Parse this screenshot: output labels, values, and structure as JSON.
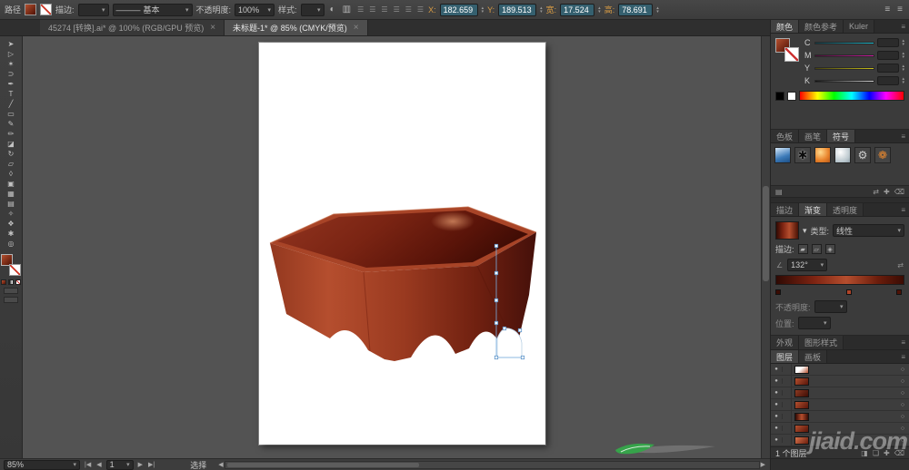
{
  "glyphs": {
    "menu": "≡",
    "close": "×",
    "dropdown": "▾",
    "up": "▴",
    "down": "▾",
    "half_circle": "◐",
    "doc": "▥",
    "align": "☰",
    "angle": "∠",
    "swap": "⇄",
    "eye": "●",
    "target": "○",
    "plus": "✚",
    "trash": "⌫",
    "folder": "❏",
    "clip": "◨",
    "library": "▤",
    "first": "|◀",
    "prev": "◀",
    "next": "▶",
    "last": "▶|",
    "gb1": "▰",
    "gb2": "▱",
    "gb3": "◈",
    "line": "———"
  },
  "top_bar": {
    "object_label": "路径",
    "stroke_label": "描边:",
    "brush_style": "基本",
    "opacity_label": "不透明度:",
    "opacity_value": "100%",
    "style_label": "样式:",
    "x_label": "X:",
    "x_value": "182.659",
    "y_label": "Y:",
    "y_value": "189.513",
    "w_label": "宽:",
    "w_value": "17.524",
    "h_label": "高:",
    "h_value": "78.691"
  },
  "document_tabs": [
    {
      "label": "45274 [转换].ai* @ 100% (RGB/GPU 预览)",
      "close": "×"
    },
    {
      "label": "未标题-1* @ 85% (CMYK/预览)",
      "close": "×",
      "active": true
    }
  ],
  "toolbar": {
    "tools": [
      {
        "name": "selection-tool",
        "glyph": "➤"
      },
      {
        "name": "direct-selection-tool",
        "glyph": "▷"
      },
      {
        "name": "magic-wand-tool",
        "glyph": "✶"
      },
      {
        "name": "lasso-tool",
        "glyph": "⊃"
      },
      {
        "name": "pen-tool",
        "glyph": "✒"
      },
      {
        "name": "type-tool",
        "glyph": "T"
      },
      {
        "name": "line-segment-tool",
        "glyph": "╱"
      },
      {
        "name": "rectangle-tool",
        "glyph": "▭"
      },
      {
        "name": "paintbrush-tool",
        "glyph": "✎"
      },
      {
        "name": "pencil-tool",
        "glyph": "✏"
      },
      {
        "name": "eraser-tool",
        "glyph": "◪"
      },
      {
        "name": "rotate-tool",
        "glyph": "↻"
      },
      {
        "name": "scale-tool",
        "glyph": "▱"
      },
      {
        "name": "width-tool",
        "glyph": "◊"
      },
      {
        "name": "free-transform-tool",
        "glyph": "▣"
      },
      {
        "name": "mesh-tool",
        "glyph": "▦"
      },
      {
        "name": "gradient-tool",
        "glyph": "▤"
      },
      {
        "name": "eyedropper-tool",
        "glyph": "✧"
      },
      {
        "name": "blend-tool",
        "glyph": "❖"
      },
      {
        "name": "hand-tool",
        "glyph": "✱"
      },
      {
        "name": "zoom-tool",
        "glyph": "◎"
      }
    ]
  },
  "panels": {
    "color": {
      "tabs": [
        {
          "label": "颜色",
          "active": true
        },
        {
          "label": "颜色参考"
        },
        {
          "label": "Kuler"
        }
      ],
      "channels": [
        "C",
        "M",
        "Y",
        "K"
      ]
    },
    "symbols": {
      "tabs": [
        {
          "label": "色板"
        },
        {
          "label": "画笔"
        },
        {
          "label": "符号",
          "active": true
        }
      ],
      "items": [
        {
          "name": "symbol-blue-square",
          "cls": "sym-blue"
        },
        {
          "name": "symbol-ink-splat",
          "cls": "sym-splat",
          "glyph": "✱"
        },
        {
          "name": "symbol-orange-sphere",
          "cls": "sym-orange"
        },
        {
          "name": "symbol-light-sphere",
          "cls": "sym-light"
        },
        {
          "name": "symbol-gear",
          "cls": "sym-gear",
          "glyph": "⚙"
        },
        {
          "name": "symbol-orange-flower",
          "cls": "sym-flower",
          "glyph": "❁"
        }
      ]
    },
    "gradient": {
      "tabs": [
        {
          "label": "描边"
        },
        {
          "label": "渐变",
          "active": true
        },
        {
          "label": "透明度"
        }
      ],
      "type_label": "类型:",
      "type_value": "线性",
      "stroke_label": "描边:",
      "angle_value": "132°",
      "opacity_label": "不透明度:",
      "location_label": "位置:",
      "stops": [
        {
          "color": "#3a0c04",
          "cls": "gs0"
        },
        {
          "color": "#b04428",
          "cls": "gs1"
        },
        {
          "color": "#4f1206",
          "cls": "gs2"
        }
      ]
    },
    "appearance": {
      "tabs": [
        {
          "label": "外观"
        },
        {
          "label": "图形样式"
        }
      ]
    },
    "layers": {
      "tabs": [
        {
          "label": "图层",
          "active": true
        },
        {
          "label": "画板"
        }
      ],
      "rows": [
        {
          "cls": "t0"
        },
        {
          "cls": "t1"
        },
        {
          "cls": "t2"
        },
        {
          "cls": "t3"
        },
        {
          "cls": "t4"
        },
        {
          "cls": "t5"
        },
        {
          "cls": "t6"
        }
      ],
      "count_label": "1 个图层"
    }
  },
  "status_bar": {
    "zoom_value": "85%",
    "artboard_value": "1",
    "status_text": "选择"
  },
  "watermark": {
    "text": "jiaid.com"
  },
  "colors": {
    "accent_red": "#a8432a",
    "selection_blue": "#7ab0e0",
    "canvas_gray": "#535353",
    "artboard_white": "#ffffff",
    "box_gradient": [
      "#b4502f",
      "#8c2f1a",
      "#4f1105"
    ],
    "gradient_angle": "132°"
  }
}
